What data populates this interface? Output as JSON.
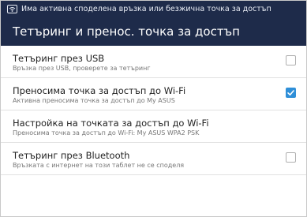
{
  "status_bar": {
    "icon": "wifi-icon",
    "notification": "Има активна споделена връзка или безжична точка за достъп"
  },
  "action_bar": {
    "title": "Тетъринг и пренос. точка за достъп"
  },
  "settings": [
    {
      "title": "Тетъринг през USB",
      "summary": "Връзка през USB, проверете за тетъринг",
      "has_checkbox": true,
      "checked": false
    },
    {
      "title": "Преносима точка за достъп до Wi-Fi",
      "summary": "Активна преносима точка за достъп до My ASUS",
      "has_checkbox": true,
      "checked": true
    },
    {
      "title": "Настройка на точката за достъп до Wi-Fi",
      "summary": "Преносима точка за достъп до Wi-Fi: My ASUS WPA2 PSK",
      "has_checkbox": false
    },
    {
      "title": "Тетъринг през Bluetooth",
      "summary": "Връзката с интернет на този таблет не се споделя",
      "has_checkbox": true,
      "checked": false
    }
  ],
  "colors": {
    "header_bg": "#1e2b4a",
    "checkbox_checked": "#2f8fd8",
    "divider": "#e1e1e1"
  }
}
